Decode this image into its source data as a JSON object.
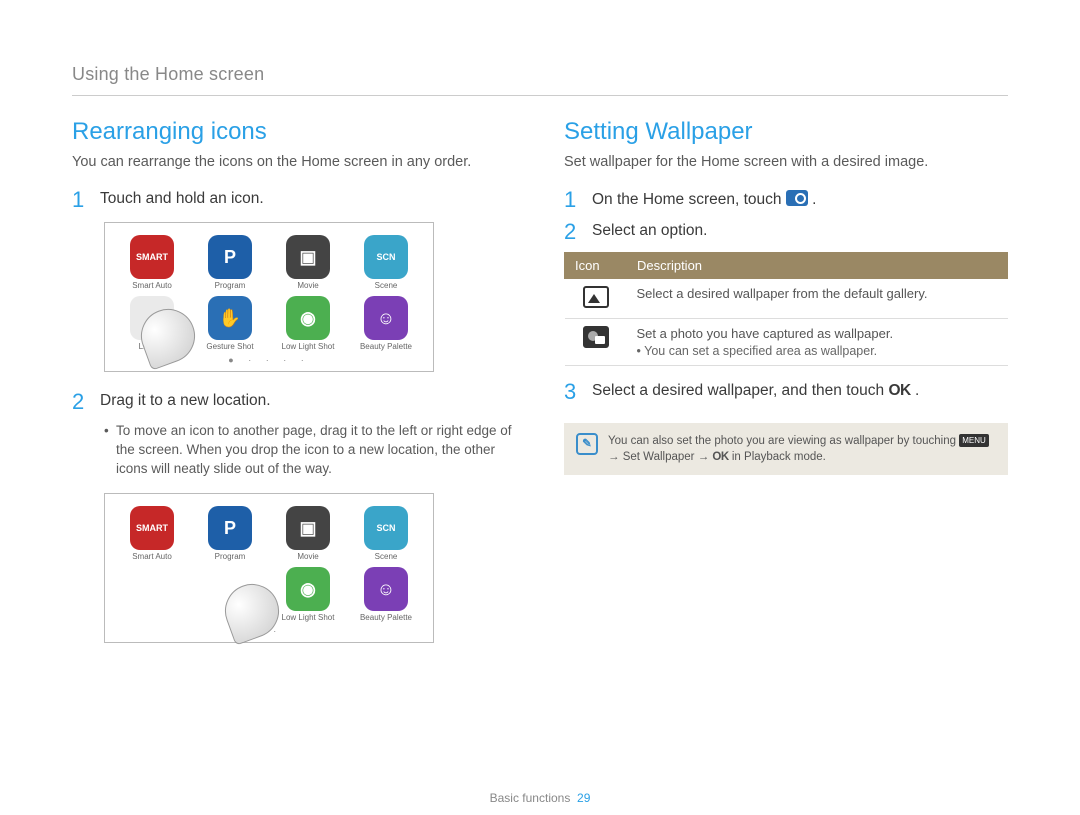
{
  "header": "Using the Home screen",
  "left": {
    "title": "Rearranging icons",
    "intro": "You can rearrange the icons on the Home screen in any order.",
    "step1": "Touch and hold an icon.",
    "step2": "Drag it to a new location.",
    "bullet2": "To move an icon to another page, drag it to the left or right edge of the screen. When you drop the icon to a new location, the other icons will neatly slide out of the way.",
    "icons": [
      {
        "label": "Smart Auto",
        "bg": "#c62828",
        "txt": "SMART"
      },
      {
        "label": "Program",
        "bg": "#1e5fa8",
        "txt": "P"
      },
      {
        "label": "Movie",
        "bg": "#444",
        "txt": "▣"
      },
      {
        "label": "Scene",
        "bg": "#3aa5c9",
        "txt": "SCN"
      },
      {
        "label": "Live Pa",
        "bg": "#eaeaea",
        "txt": ""
      },
      {
        "label": "Gesture Shot",
        "bg": "#2a6fb5",
        "txt": "✋"
      },
      {
        "label": "Low Light Shot",
        "bg": "#4caf50",
        "txt": "◉"
      },
      {
        "label": "Beauty Palette",
        "bg": "#7b3fb5",
        "txt": "☺"
      }
    ]
  },
  "right": {
    "title": "Setting Wallpaper",
    "intro": "Set wallpaper for the Home screen with a desired image.",
    "step1_a": "On the Home screen, touch ",
    "step1_b": " .",
    "step2": "Select an option.",
    "step3_a": "Select a desired wallpaper, and then touch ",
    "step3_b": " .",
    "table": {
      "h_icon": "Icon",
      "h_desc": "Description",
      "r1": "Select a desired wallpaper from the default gallery.",
      "r2": "Set a photo you have captured as wallpaper.",
      "r2_sub": "You can set a specified area as wallpaper."
    },
    "note_a": "You can also set the photo you are viewing as wallpaper by touching ",
    "note_b": " → ",
    "note_c": "Set Wallpaper",
    "note_d": " → ",
    "note_e": " in Playback mode.",
    "menu_label": "MENU",
    "ok_label": "OK"
  },
  "footer": {
    "section": "Basic functions",
    "page": "29"
  }
}
